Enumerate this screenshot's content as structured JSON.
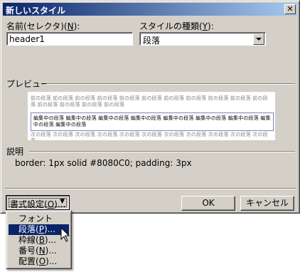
{
  "window": {
    "title": "新しいスタイル",
    "close_icon": "close-icon"
  },
  "name_field": {
    "label": "名前(セレクタ)(N):",
    "label_text": "名前(セレクタ)(",
    "label_key": "N",
    "label_end": "):",
    "value": "header1"
  },
  "style_type": {
    "label_text": "スタイルの種類(",
    "label_key": "Y",
    "label_end": "):",
    "value": "段落"
  },
  "preview": {
    "label": "プレビュー",
    "prev_paragraph": "前の段落 前の段落 前の段落 前の段落 前の段落 前の段落 前の段落 前の段落 前の段落 前の段落 前の段落 前の段落 前の段落 前の段落 前の段落",
    "current_paragraph": "編集中の段落 編集中の段落 編集中の段落 編集中の段落 編集中の段落 編集中の段落 編集中の段落 編集中の段落 編集中の段落",
    "next_paragraph": "次の段落 次の段落 次の段落 次の段落 次の段落 次の段落 次の段落 次の段落 次の段落 次の段落 次の段落"
  },
  "description": {
    "label": "説明",
    "text": "border: 1px solid #8080C0; padding: 3px"
  },
  "buttons": {
    "format_text": "書式設定(",
    "format_key": "O",
    "format_end": ")...",
    "format_arrow": "▼",
    "ok": "OK",
    "cancel": "キャンセル"
  },
  "format_menu": {
    "items": [
      {
        "text": "フォント(",
        "key": "F",
        "end": ")..."
      },
      {
        "text": "段落(",
        "key": "P",
        "end": ")..."
      },
      {
        "text": "枠線(",
        "key": "B",
        "end": ")..."
      },
      {
        "text": "番号(",
        "key": "N",
        "end": ")..."
      },
      {
        "text": "配置(",
        "key": "O",
        "end": ")..."
      }
    ],
    "selected_index": 1
  },
  "colors": {
    "title_bar_start": "#0a246a",
    "title_bar_end": "#a6caf0",
    "dialog_face": "#d4d0c8",
    "preview_border": "#8080c0"
  }
}
